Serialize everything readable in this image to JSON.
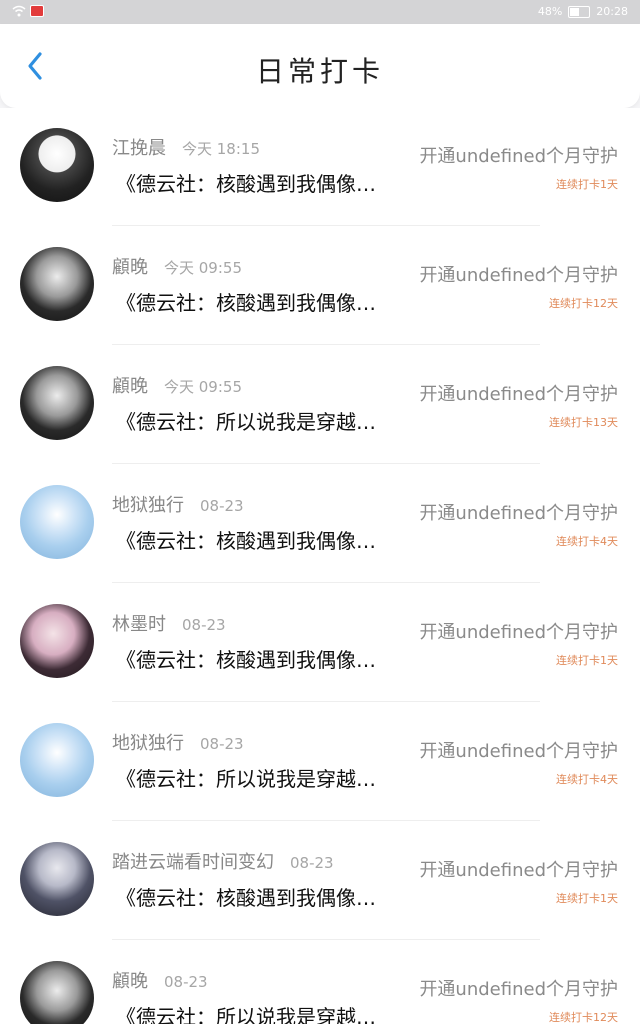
{
  "status_bar": {
    "battery_percent": "48%",
    "time": "20:28",
    "colors": {
      "background": "#d4d4d6",
      "notification": "#e23b3b"
    }
  },
  "header": {
    "title": "日常打卡",
    "back_icon": "chevron-left-icon",
    "accent_color": "#2f8fe0"
  },
  "feed": {
    "items": [
      {
        "name": "江挽晨",
        "time": "今天 18:15",
        "message": "《德云社：核酸遇到我偶像…",
        "guard_text": "开通undefined个月守护",
        "streak": "连续打卡1天",
        "avatar_style": "dark"
      },
      {
        "name": "顧晚",
        "time": "今天 09:55",
        "message": "《德云社：核酸遇到我偶像…",
        "guard_text": "开通undefined个月守护",
        "streak": "连续打卡12天",
        "avatar_style": "mono"
      },
      {
        "name": "顧晚",
        "time": "今天 09:55",
        "message": "《德云社：所以说我是穿越…",
        "guard_text": "开通undefined个月守护",
        "streak": "连续打卡13天",
        "avatar_style": "mono"
      },
      {
        "name": "地狱独行",
        "time": "08-23",
        "message": "《德云社：核酸遇到我偶像…",
        "guard_text": "开通undefined个月守护",
        "streak": "连续打卡4天",
        "avatar_style": "blue"
      },
      {
        "name": "林墨时",
        "time": "08-23",
        "message": "《德云社：核酸遇到我偶像…",
        "guard_text": "开通undefined个月守护",
        "streak": "连续打卡1天",
        "avatar_style": "pink"
      },
      {
        "name": "地狱独行",
        "time": "08-23",
        "message": "《德云社：所以说我是穿越…",
        "guard_text": "开通undefined个月守护",
        "streak": "连续打卡4天",
        "avatar_style": "blue"
      },
      {
        "name": "踏进云端看时间变幻",
        "time": "08-23",
        "message": "《德云社：核酸遇到我偶像…",
        "guard_text": "开通undefined个月守护",
        "streak": "连续打卡1天",
        "avatar_style": "ghost"
      },
      {
        "name": "顧晚",
        "time": "08-23",
        "message": "《德云社：所以说我是穿越…",
        "guard_text": "开通undefined个月守护",
        "streak": "连续打卡12天",
        "avatar_style": "mono"
      }
    ]
  }
}
